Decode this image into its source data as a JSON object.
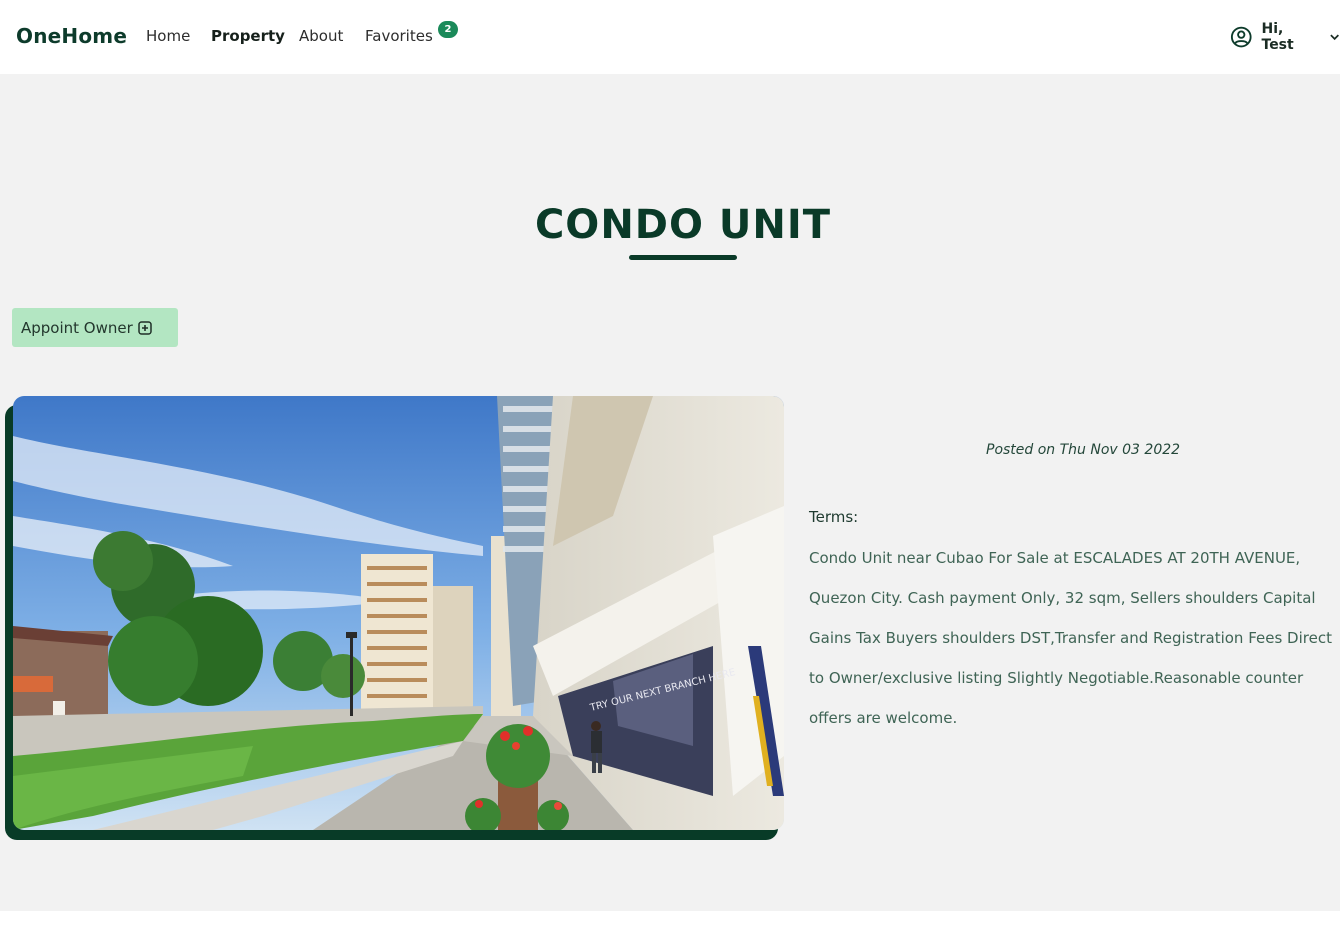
{
  "navbar": {
    "brand": "OneHome",
    "links": [
      {
        "label": "Home"
      },
      {
        "label": "Property"
      },
      {
        "label": "About"
      },
      {
        "label": "Favorites"
      }
    ],
    "favorites_count": "2",
    "user_greeting": "Hi, Test"
  },
  "listing": {
    "title": "CONDO UNIT",
    "appoint_button": "Appoint Owner",
    "posted": "Posted on Thu Nov 03 2022",
    "terms_label": "Terms:",
    "terms_text": "Condo Unit near Cubao For Sale at ESCALADES AT 20TH AVENUE, Quezon City. Cash payment Only, 32 sqm, Sellers shoulders Capital Gains Tax Buyers shoulders DST,Transfer and Registration Fees Direct to Owner/exclusive listing Slightly Negotiable.Reasonable counter offers are welcome.",
    "photo_sign_text": "TRY OUR NEXT BRANCH HERE"
  },
  "colors": {
    "brand_dark_green": "#0a3a28",
    "badge_green": "#1b8a5a",
    "button_light_green": "#b3e6c2",
    "page_background": "#f2f2f2"
  },
  "icons": {
    "user": "user-circle-icon",
    "dropdown": "chevron-down-icon",
    "appoint": "plus-square-icon"
  }
}
